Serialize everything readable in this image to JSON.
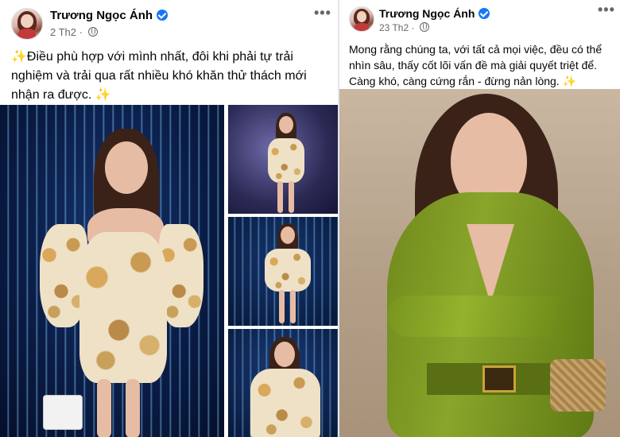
{
  "posts": [
    {
      "author": "Trương Ngọc Ánh",
      "date": "2 Th2",
      "privacy_icon": "globe-icon",
      "more_icon": "more-horizontal-icon",
      "caption": {
        "emoji_start": "✨",
        "text": "Điều phù hợp với mình nhất, đôi khi phải tự trải nghiệm và trải qua rất nhiều khó khăn thử thách mới nhận ra được.",
        "emoji_end": "✨"
      }
    },
    {
      "author": "Trương Ngọc Ánh",
      "date": "23 Th2",
      "privacy_icon": "globe-icon",
      "more_icon": "more-horizontal-icon",
      "caption": {
        "text": "Mong rằng chúng ta, với tất cả mọi việc, đều có thể nhìn sâu, thấy cốt lõi vấn đề mà giải quyết triệt để. Càng khó, càng cứng rắn - đừng nản lòng.",
        "emoji_end": "✨"
      }
    }
  ],
  "icons": {
    "more": "•••",
    "verified": "verified-badge-icon"
  },
  "colors": {
    "verified": "#1877f2",
    "meta": "#65676b",
    "sparkle": "#f4c430",
    "dress_green": "#7d9823"
  }
}
